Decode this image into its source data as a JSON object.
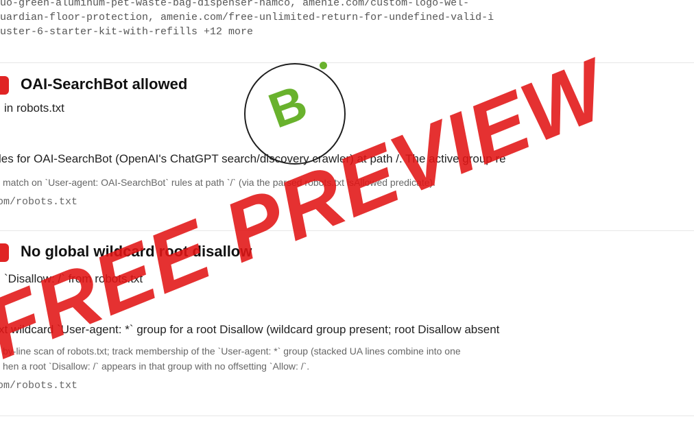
{
  "top_lines": [
    "uo-green-aluminum-pet-waste-bag-dispenser-hamco, amenie.com/custom-logo-wel-",
    "uardian-floor-protection, amenie.com/free-unlimited-return-for-undefined-valid-i",
    "uster-6-starter-kit-with-refills +12 more"
  ],
  "grade": {
    "letter": "B",
    "color": "#69b22d"
  },
  "checks": [
    {
      "title": "OAI-SearchBot allowed",
      "subtitle": "in robots.txt",
      "detail": "les for OAI-SearchBot (OpenAI's ChatGPT search/discovery crawler) at path /. The active group re",
      "method_lines": [
        "match on `User-agent: OAI-SearchBot` rules at path `/` (via the parsed robots.txt isAllowed predicate)."
      ],
      "url": "om/robots.txt",
      "status_color": "#e02424"
    },
    {
      "title": "No global wildcard root disallow",
      "subtitle": "`Disallow: /` from robots.txt",
      "detail": "xt wildcard `User-agent: *` group for a root Disallow (wildcard group present; root Disallow absent",
      "method_lines": [
        "by-line scan of robots.txt; track membership of the `User-agent: *` group (stacked UA lines combine into one",
        "hen a root `Disallow: /` appears in that group with no offsetting `Allow: /`."
      ],
      "url": "om/robots.txt",
      "status_color": "#e02424"
    }
  ],
  "watermark": "FREE PREVIEW"
}
